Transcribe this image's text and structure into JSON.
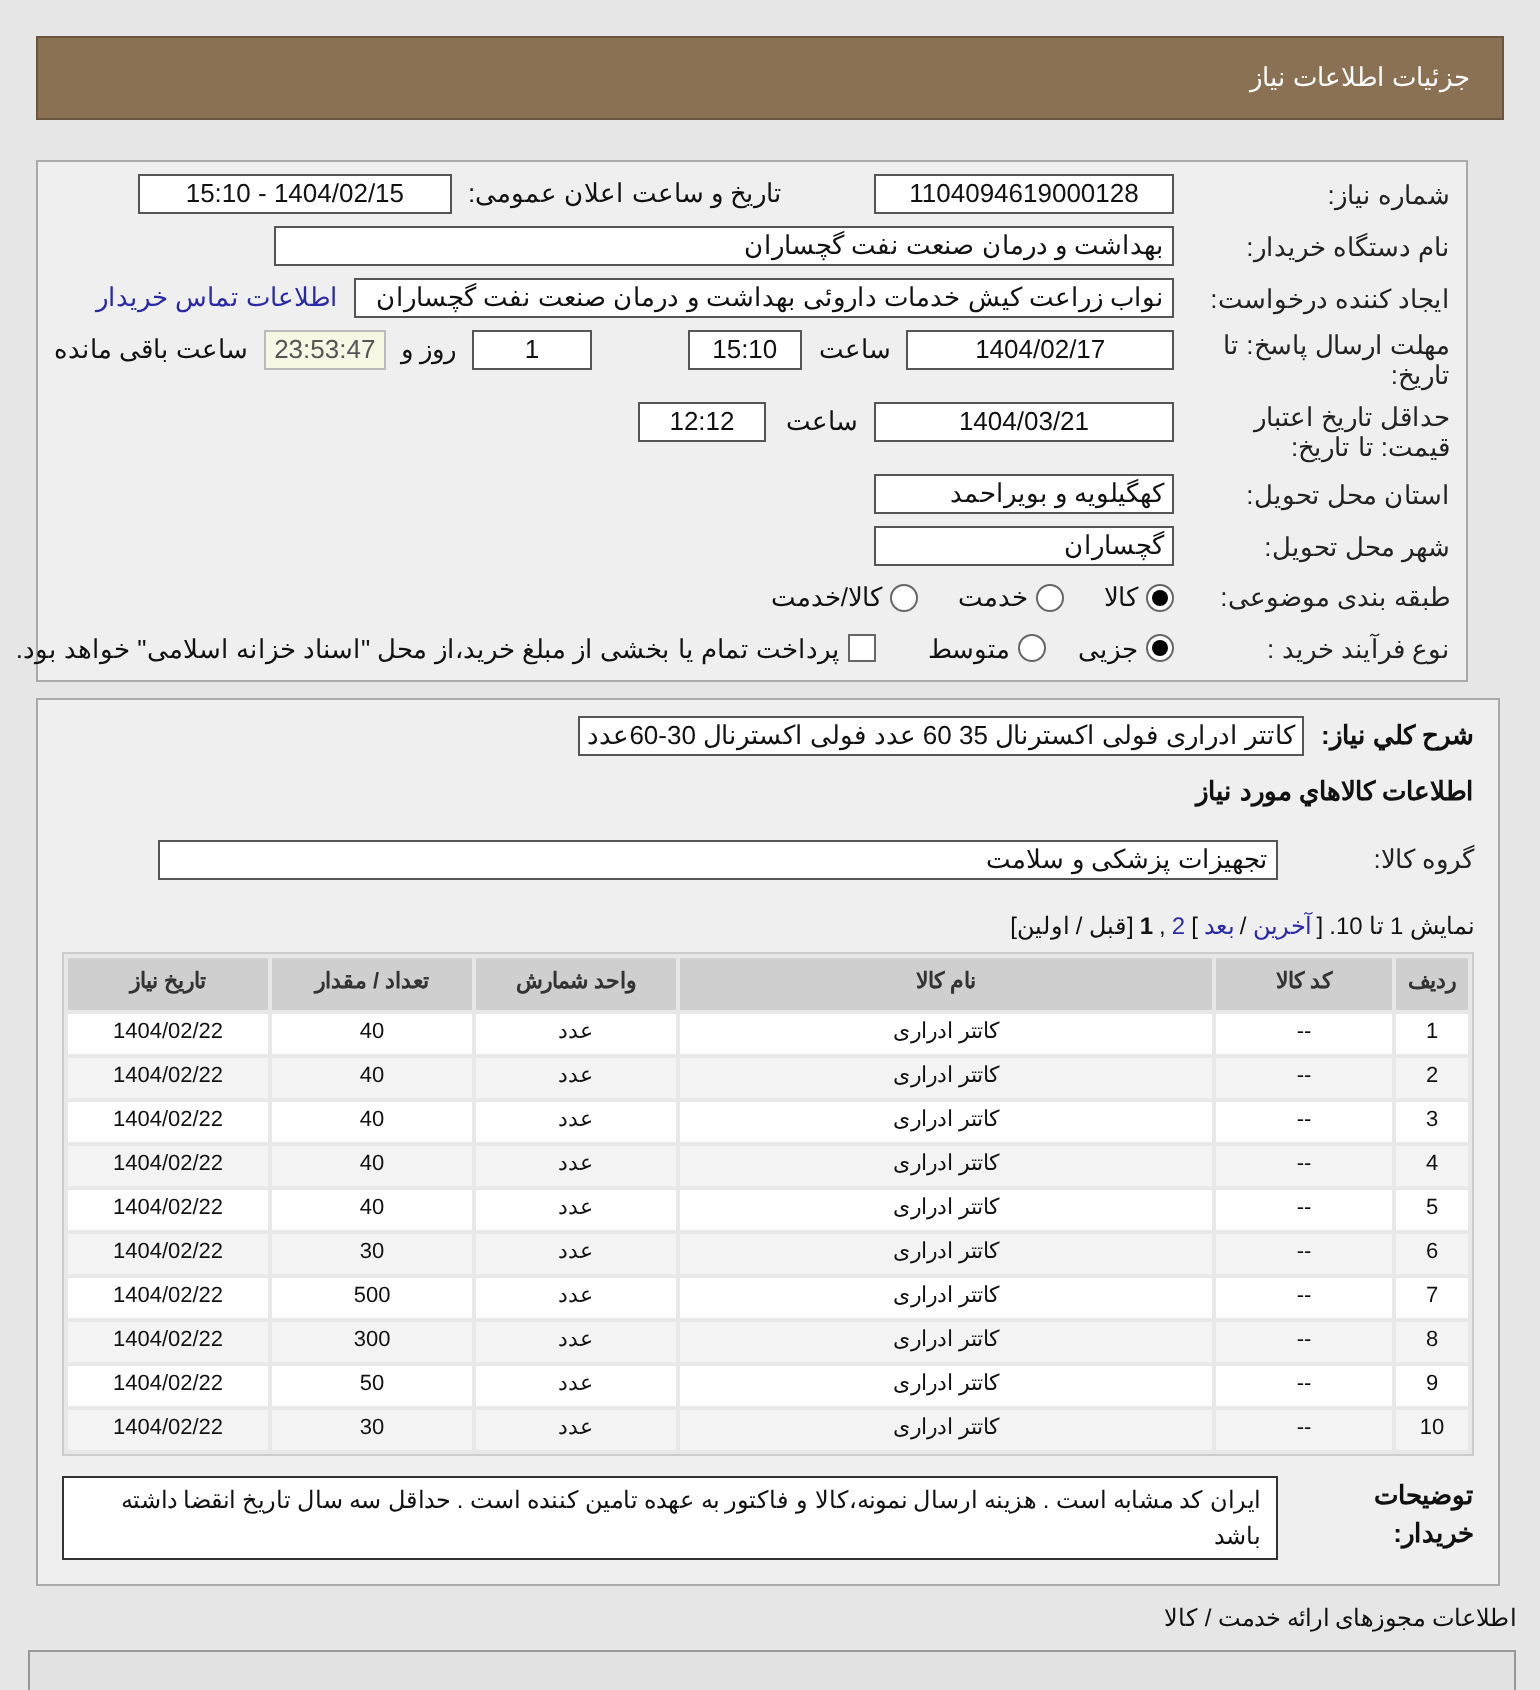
{
  "header": {
    "title": "جزئیات اطلاعات نیاز"
  },
  "form": {
    "need_number": {
      "label": "شماره نیاز:",
      "value": "1104094619000128"
    },
    "announce": {
      "label": "تاریخ و ساعت اعلان عمومی:",
      "value": "1404/02/15 - 15:10"
    },
    "buyer": {
      "label": "نام دستگاه خریدار:",
      "value": "بهداشت و درمان صنعت نفت گچساران"
    },
    "creator": {
      "label": "ایجاد کننده درخواست:",
      "value": "نواب زراعت کیش خدمات داروئی بهداشت و درمان صنعت نفت گچساران",
      "link": "اطلاعات تماس خریدار"
    },
    "deadline": {
      "label": "مهلت ارسال پاسخ: تا تاریخ:",
      "date": "1404/02/17",
      "time_label": "ساعت",
      "time": "15:10",
      "days": "1",
      "days_label": "روز و",
      "remaining": "23:53:47",
      "remaining_label": "ساعت باقی مانده"
    },
    "validity": {
      "label": "حداقل تاریخ اعتبار قیمت: تا تاریخ:",
      "date": "1404/03/21",
      "time_label": "ساعت",
      "time": "12:12"
    },
    "province": {
      "label": "استان محل تحویل:",
      "value": "کهگیلویه و بویراحمد"
    },
    "city": {
      "label": "شهر محل تحویل:",
      "value": "گچساران"
    },
    "category": {
      "label": "طبقه بندی موضوعی:",
      "options": [
        {
          "label": "کالا",
          "selected": true
        },
        {
          "label": "خدمت",
          "selected": false
        },
        {
          "label": "کالا/خدمت",
          "selected": false
        }
      ]
    },
    "process": {
      "label": "نوع فرآیند خرید :",
      "options": [
        {
          "label": "جزیی",
          "selected": true
        },
        {
          "label": "متوسط",
          "selected": false
        }
      ],
      "treasury": {
        "checked": false,
        "label": "پرداخت تمام یا بخشی از مبلغ خرید،از محل \"اسناد خزانه اسلامی\" خواهد بود."
      }
    }
  },
  "details": {
    "summary": {
      "label": "شرح کلي نياز:",
      "value": "کاتتر ادراری فولی اکسترنال 35 60 عدد فولی اکسترنال 30-60عدد"
    },
    "goods_heading": "اطلاعات کالاهاي مورد نياز",
    "group": {
      "label": "گروه کالا:",
      "value": "تجهیزات پزشکی و سلامت"
    },
    "pagination": [
      {
        "label": "نمایش 1 تا 10.",
        "kind": "text"
      },
      {
        "label": "[",
        "kind": "text"
      },
      {
        "label": "آخرین",
        "kind": "link"
      },
      {
        "label": "/",
        "kind": "text"
      },
      {
        "label": "بعد",
        "kind": "link"
      },
      {
        "label": "]",
        "kind": "text"
      },
      {
        "label": "2",
        "kind": "link"
      },
      {
        "label": ",",
        "kind": "text"
      },
      {
        "label": "1",
        "kind": "current"
      },
      {
        "label": "[قبل / اولین]",
        "kind": "text"
      }
    ],
    "table": {
      "columns": [
        "ردیف",
        "کد کالا",
        "نام کالا",
        "واحد شمارش",
        "تعداد / مقدار",
        "تاریخ نیاز"
      ],
      "rows": [
        [
          "1",
          "--",
          "کاتتر ادراری",
          "عدد",
          "40",
          "1404/02/22"
        ],
        [
          "2",
          "--",
          "کاتتر ادراری",
          "عدد",
          "40",
          "1404/02/22"
        ],
        [
          "3",
          "--",
          "کاتتر ادراری",
          "عدد",
          "40",
          "1404/02/22"
        ],
        [
          "4",
          "--",
          "کاتتر ادراری",
          "عدد",
          "40",
          "1404/02/22"
        ],
        [
          "5",
          "--",
          "کاتتر ادراری",
          "عدد",
          "40",
          "1404/02/22"
        ],
        [
          "6",
          "--",
          "کاتتر ادراری",
          "عدد",
          "30",
          "1404/02/22"
        ],
        [
          "7",
          "--",
          "کاتتر ادراری",
          "عدد",
          "500",
          "1404/02/22"
        ],
        [
          "8",
          "--",
          "کاتتر ادراری",
          "عدد",
          "300",
          "1404/02/22"
        ],
        [
          "9",
          "--",
          "کاتتر ادراری",
          "عدد",
          "50",
          "1404/02/22"
        ],
        [
          "10",
          "--",
          "کاتتر ادراری",
          "عدد",
          "30",
          "1404/02/22"
        ]
      ]
    },
    "notes": {
      "label": "توضیحات خریدار:",
      "value": "ایران کد مشابه است . هزینه ارسال نمونه،کالا و فاکتور به عهده تامین کننده است . حداقل سه سال تاریخ انقضا داشته باشد"
    }
  },
  "licenses": {
    "title": "اطلاعات مجوزهای ارائه خدمت / کالا"
  }
}
